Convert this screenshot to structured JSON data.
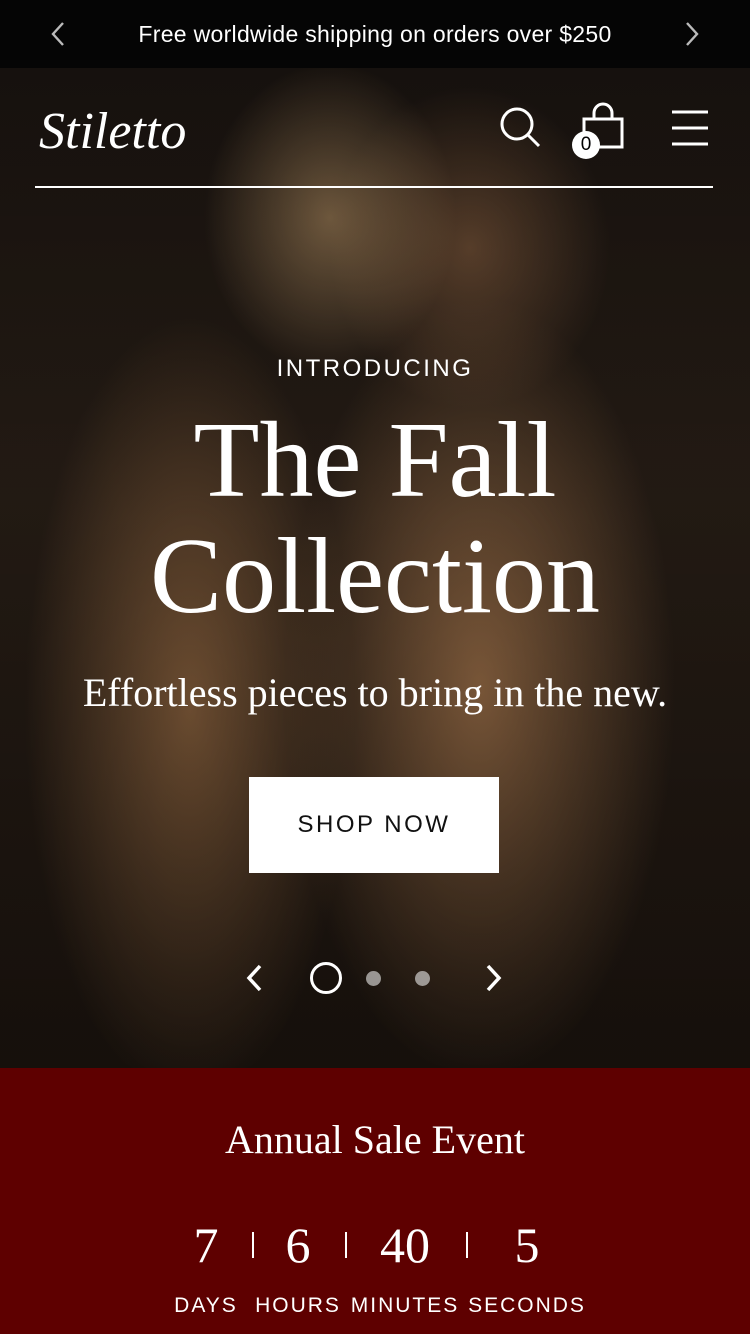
{
  "announcement": {
    "text": "Free worldwide shipping on orders over $250",
    "prev_icon": "chevron-left-icon",
    "next_icon": "chevron-right-icon"
  },
  "header": {
    "logo_text": "Stiletto",
    "search_icon": "search-icon",
    "cart_icon": "shopping-bag-icon",
    "cart_count": "0",
    "menu_icon": "hamburger-menu-icon"
  },
  "hero": {
    "eyebrow": "INTRODUCING",
    "headline_line1": "The Fall",
    "headline_line2": "Collection",
    "subline": "Effortless pieces to bring in the new.",
    "cta_label": "SHOP NOW",
    "slides_total": 3,
    "active_slide": 1
  },
  "sale": {
    "title": "Annual Sale Event",
    "countdown": [
      {
        "value": "7",
        "label": "DAYS"
      },
      {
        "value": "6",
        "label": "HOURS"
      },
      {
        "value": "40",
        "label": "MINUTES"
      },
      {
        "value": "5",
        "label": "SECONDS"
      }
    ],
    "background_color": "#5e0000"
  }
}
